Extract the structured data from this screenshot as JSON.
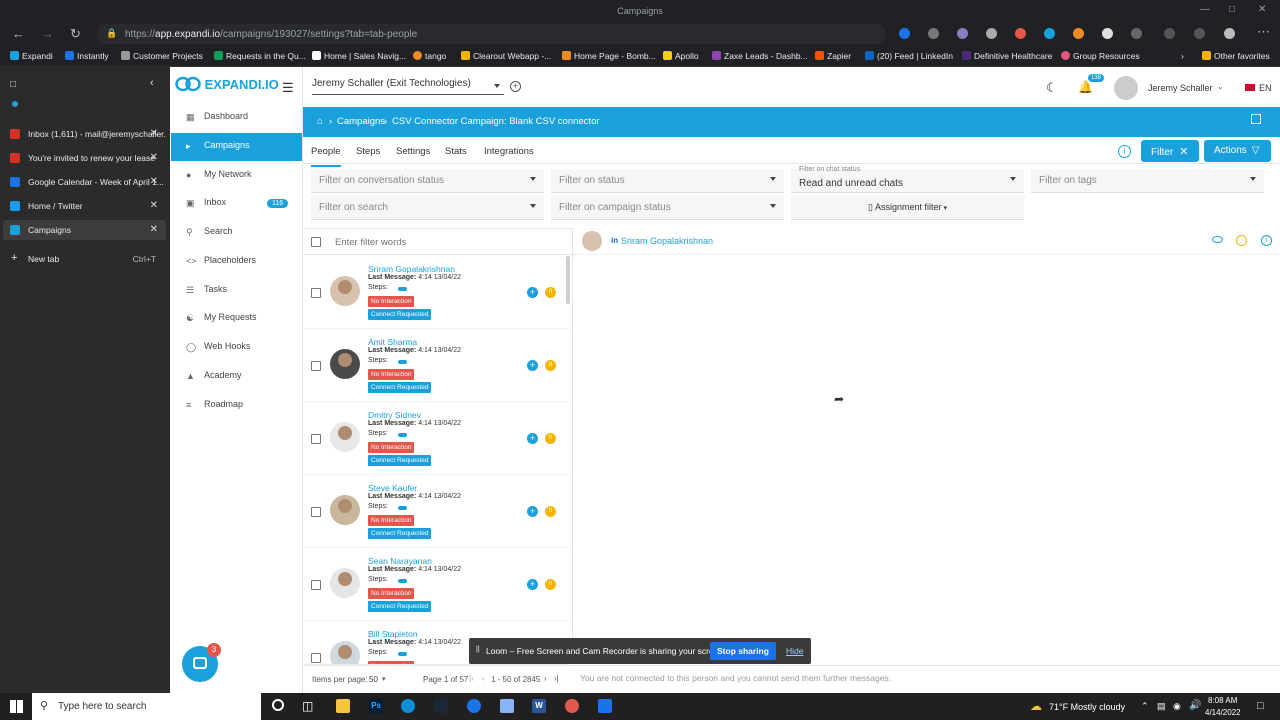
{
  "browser": {
    "window_title": "Campaigns",
    "url_prefix": "https://",
    "url_host": "app.expandi.io",
    "url_path": "/campaigns/193027/settings?tab=tab-people",
    "bookmarks": [
      "Expandi",
      "Instantly",
      "Customer Projects",
      "Requests in the Qu...",
      "Home | Sales Navig...",
      "tango",
      "Clearout Webapp -...",
      "Home Page - Bomb...",
      "Apollo",
      "Zaxe Leads - Dashb...",
      "Zapier",
      "(20) Feed | LinkedIn",
      "Definitive Healthcare",
      "Group Resources"
    ],
    "other_favorites": "Other favorites",
    "tabs": [
      {
        "title": "Inbox (1,611) - mail@jeremyschaller...",
        "color": "#d93025"
      },
      {
        "title": "You're invited to renew your lease",
        "color": "#d93025"
      },
      {
        "title": "Google Calendar - Week of April 1...",
        "color": "#1a73e8"
      },
      {
        "title": "Home / Twitter",
        "color": "#1d9bf0"
      },
      {
        "title": "Campaigns",
        "color": "#1aa1dc"
      }
    ],
    "new_tab": "New tab",
    "new_tab_shortcut": "Ctrl+T"
  },
  "app": {
    "logo": "EXPANDI.IO",
    "nav": [
      {
        "label": "Dashboard",
        "icon": "dashboard-icon"
      },
      {
        "label": "Campaigns",
        "icon": "campaigns-icon"
      },
      {
        "label": "My Network",
        "icon": "network-icon"
      },
      {
        "label": "Inbox",
        "icon": "inbox-icon"
      },
      {
        "label": "Search",
        "icon": "search-icon"
      },
      {
        "label": "Placeholders",
        "icon": "code-icon"
      },
      {
        "label": "Tasks",
        "icon": "tasks-icon"
      },
      {
        "label": "My Requests",
        "icon": "requests-icon"
      },
      {
        "label": "Web Hooks",
        "icon": "webhook-icon"
      },
      {
        "label": "Academy",
        "icon": "academy-icon"
      },
      {
        "label": "Roadmap",
        "icon": "roadmap-icon"
      }
    ],
    "inbox_badge": "116",
    "workspace": "Jeremy Schaller (Exit Technologies)",
    "notif_count": "138",
    "user_name": "Jeremy Schaller",
    "language": "EN",
    "breadcrumb_root": "Campaigns",
    "breadcrumb_current": "CSV Connector Campaign: Blank CSV connector"
  },
  "tabs": [
    "People",
    "Steps",
    "Settings",
    "Stats",
    "Integrations"
  ],
  "filter_button": "Filter",
  "actions_button": "Actions",
  "filters": {
    "conversation": "Filter on conversation status",
    "status": "Filter on status",
    "chat_label": "Filter on chat status",
    "chat_value": "Read and unread chats",
    "tags": "Filter on tags",
    "search": "Filter on search",
    "campaign": "Filter on campaign status",
    "assignment": "Assignment filter"
  },
  "filter_words_placeholder": "Enter filter words",
  "selected_person": "Sriram Gopalakrishnan",
  "people": [
    {
      "name": "Sriram Gopalakrishnan",
      "last": "4:14 13/04/22"
    },
    {
      "name": "Amit Sharma",
      "last": "4:14 13/04/22"
    },
    {
      "name": "Dmitry Sidnev",
      "last": "4:14 13/04/22"
    },
    {
      "name": "Steve Kaufer",
      "last": "4:14 13/04/22"
    },
    {
      "name": "Sean Narayanan",
      "last": "4:14 13/04/22"
    },
    {
      "name": "Bill Stapleton",
      "last": "4:14 13/04/22"
    }
  ],
  "row_labels": {
    "last": "Last Message:",
    "steps": "Steps:",
    "tag1": "No Interaction",
    "tag2": "Connect Requested"
  },
  "footer": {
    "items_label": "Items per page:",
    "items_value": "50",
    "page_info": "Page 1 of 57",
    "range": "1 - 50 of 2845",
    "not_connected": "You are not connected to this person and you cannot send them further messages."
  },
  "loom": {
    "text": "Loom – Free Screen and Cam Recorder is sharing your screen.",
    "stop": "Stop sharing",
    "hide": "Hide"
  },
  "chat_badge": "3",
  "taskbar": {
    "search_placeholder": "Type here to search",
    "weather": "71°F  Mostly cloudy",
    "time": "8:08 AM",
    "date": "4/14/2022"
  }
}
